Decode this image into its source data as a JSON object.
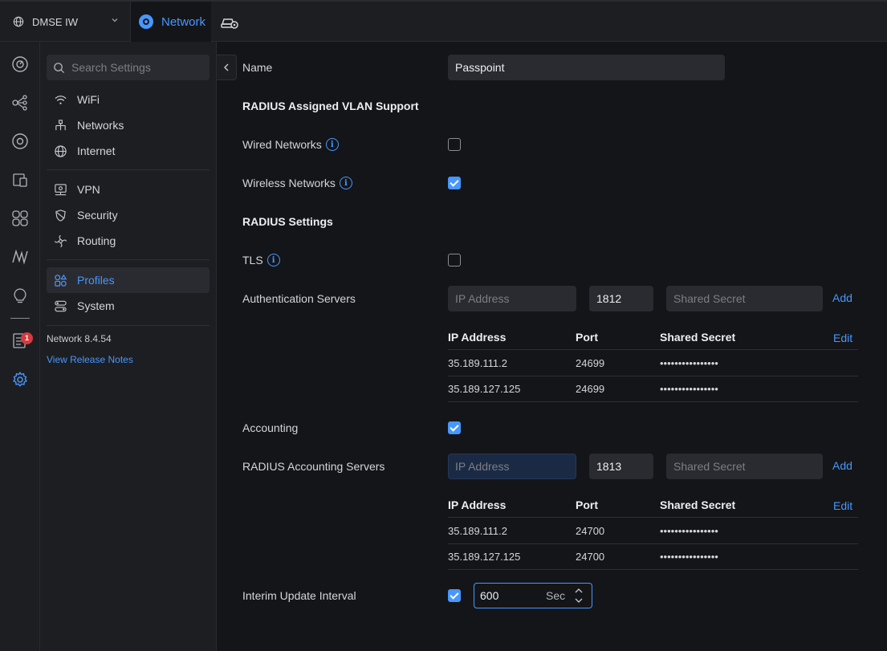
{
  "topbar": {
    "site_name": "DMSE IW",
    "app_name": "Network"
  },
  "nav": {
    "search_placeholder": "Search Settings",
    "items": [
      {
        "label": "WiFi"
      },
      {
        "label": "Networks"
      },
      {
        "label": "Internet"
      },
      {
        "label": "VPN"
      },
      {
        "label": "Security"
      },
      {
        "label": "Routing"
      },
      {
        "label": "Profiles"
      },
      {
        "label": "System"
      }
    ],
    "version": "Network 8.4.54",
    "release_notes": "View Release Notes"
  },
  "rail": {
    "notification_count": "1"
  },
  "form": {
    "name_label": "Name",
    "name_value": "Passpoint",
    "vlan_section": "RADIUS Assigned VLAN Support",
    "wired_label": "Wired Networks",
    "wired_checked": false,
    "wireless_label": "Wireless Networks",
    "wireless_checked": true,
    "radius_section": "RADIUS Settings",
    "tls_label": "TLS",
    "tls_checked": false,
    "auth_label": "Authentication Servers",
    "auth_ip_placeholder": "IP Address",
    "auth_port": "1812",
    "auth_secret_placeholder": "Shared Secret",
    "add_label": "Add",
    "edit_label": "Edit",
    "table_headers": [
      "IP Address",
      "Port",
      "Shared Secret"
    ],
    "auth_servers": [
      {
        "ip": "35.189.111.2",
        "port": "24699",
        "secret": "••••••••••••••••"
      },
      {
        "ip": "35.189.127.125",
        "port": "24699",
        "secret": "••••••••••••••••"
      }
    ],
    "accounting_label": "Accounting",
    "accounting_checked": true,
    "acct_label": "RADIUS Accounting Servers",
    "acct_ip_placeholder": "IP Address",
    "acct_port": "1813",
    "acct_secret_placeholder": "Shared Secret",
    "acct_servers": [
      {
        "ip": "35.189.111.2",
        "port": "24700",
        "secret": "••••••••••••••••"
      },
      {
        "ip": "35.189.127.125",
        "port": "24700",
        "secret": "••••••••••••••••"
      }
    ],
    "interim_label": "Interim Update Interval",
    "interim_checked": true,
    "interim_value": "600",
    "interim_unit": "Sec"
  },
  "colors": {
    "accent": "#4797ff",
    "badge": "#d63a3f",
    "background": "#141518",
    "panel": "#1d1e22"
  }
}
